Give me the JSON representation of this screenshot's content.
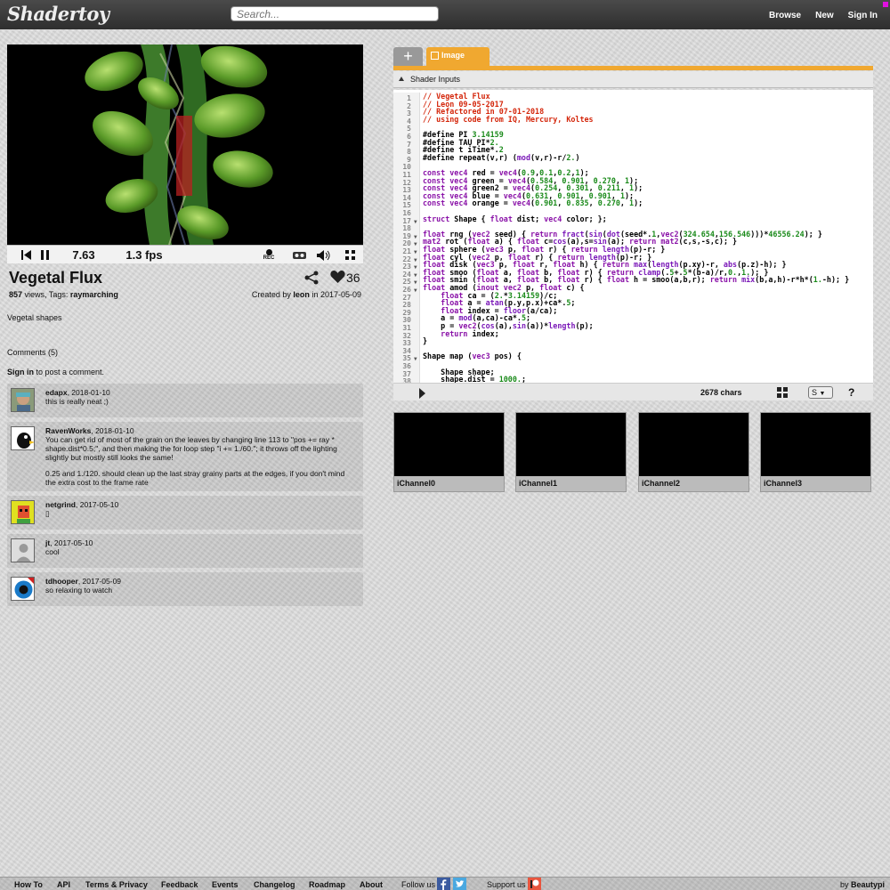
{
  "header": {
    "logo": "Shadertoy",
    "search_placeholder": "Search...",
    "nav": [
      "Browse",
      "New",
      "Sign In"
    ],
    "accent": "#e010e0"
  },
  "player": {
    "time": "7.63",
    "fps": "1.3 fps",
    "rec_label": "REC"
  },
  "shader": {
    "title": "Vegetal Flux",
    "likes": "36",
    "views": "857",
    "views_label": " views, Tags: ",
    "tag": "raymarching",
    "created_prefix": "Created by ",
    "author": "leon",
    "date_prefix": " in ",
    "date": "2017-05-09",
    "description": "Vegetal shapes"
  },
  "comments_section": {
    "header": "Comments (5)",
    "signin": "Sign in",
    "signin_suffix": " to post a comment."
  },
  "comments": [
    {
      "user": "edapx",
      "date": ", 2018-01-10",
      "text": [
        "this is really neat ;)"
      ]
    },
    {
      "user": "RavenWorks",
      "date": ", 2018-01-10",
      "text": [
        "You can get rid of most of the grain on the leaves by changing line 113 to \"pos += ray * shape.dist*0.5;\", and then making the for loop step \"i += 1./60.\"; it throws off the lighting slightly but mostly still looks the same!",
        "0.25 and 1./120. should clean up the last stray grainy parts at the edges, if you don't mind the extra cost to the frame rate"
      ]
    },
    {
      "user": "netgrind",
      "date": ", 2017-05-10",
      "text": [
        "▯"
      ]
    },
    {
      "user": "jt",
      "date": ", 2017-05-10",
      "text": [
        "cool"
      ]
    },
    {
      "user": "tdhooper",
      "date": ", 2017-05-09",
      "text": [
        "so relaxing to watch"
      ]
    }
  ],
  "editor": {
    "tab_plus": "+",
    "tab_image": "Image",
    "inputs_label": "Shader Inputs",
    "chars": "2678 chars",
    "select_value": "S",
    "help": "?",
    "accent": "#f0a830"
  },
  "code_lines": [
    {
      "n": "1",
      "t": "// Vegetal Flux",
      "cls": "c"
    },
    {
      "n": "2",
      "t": "// Leon 09-05-2017",
      "cls": "c"
    },
    {
      "n": "3",
      "t": "// Refactored in 07-01-2018",
      "cls": "c"
    },
    {
      "n": "4",
      "t": "// using code from IQ, Mercury, Koltes",
      "cls": "c"
    },
    {
      "n": "5",
      "t": "",
      "cls": "p"
    },
    {
      "n": "6",
      "t": "#define PI 3.14159",
      "cls": "p"
    },
    {
      "n": "7",
      "t": "#define TAU PI*2.",
      "cls": "p"
    },
    {
      "n": "8",
      "t": "#define t iTime*.2",
      "cls": "p"
    },
    {
      "n": "9",
      "t": "#define repeat(v,r) (mod(v,r)-r/2.)",
      "cls": "p"
    },
    {
      "n": "10",
      "t": "",
      "cls": "p"
    },
    {
      "n": "11",
      "t": "const vec4 red = vec4(0.9,0.1,0.2,1);",
      "cls": "p"
    },
    {
      "n": "12",
      "t": "const vec4 green = vec4(0.584, 0.901, 0.270, 1);",
      "cls": "p"
    },
    {
      "n": "13",
      "t": "const vec4 green2 = vec4(0.254, 0.301, 0.211, 1);",
      "cls": "p"
    },
    {
      "n": "14",
      "t": "const vec4 blue = vec4(0.631, 0.901, 0.901, 1);",
      "cls": "p"
    },
    {
      "n": "15",
      "t": "const vec4 orange = vec4(0.901, 0.835, 0.270, 1);",
      "cls": "p"
    },
    {
      "n": "16",
      "t": "",
      "cls": "p"
    },
    {
      "n": "17",
      "t": "struct Shape { float dist; vec4 color; };",
      "cls": "p"
    },
    {
      "n": "18",
      "t": "",
      "cls": "p"
    },
    {
      "n": "19",
      "t": "float rng (vec2 seed) { return fract(sin(dot(seed*.1,vec2(324.654,156.546)))*46556.24); }",
      "cls": "p"
    },
    {
      "n": "20",
      "t": "mat2 rot (float a) { float c=cos(a),s=sin(a); return mat2(c,s,-s,c); }",
      "cls": "p"
    },
    {
      "n": "21",
      "t": "float sphere (vec3 p, float r) { return length(p)-r; }",
      "cls": "p"
    },
    {
      "n": "22",
      "t": "float cyl (vec2 p, float r) { return length(p)-r; }",
      "cls": "p"
    },
    {
      "n": "23",
      "t": "float disk (vec3 p, float r, float h) { return max(length(p.xy)-r, abs(p.z)-h); }",
      "cls": "p"
    },
    {
      "n": "24",
      "t": "float smoo (float a, float b, float r) { return clamp(.5+.5*(b-a)/r,0.,1.); }",
      "cls": "p"
    },
    {
      "n": "25",
      "t": "float smin (float a, float b, float r) { float h = smoo(a,b,r); return mix(b,a,h)-r*h*(1.-h); }",
      "cls": "p"
    },
    {
      "n": "26",
      "t": "float amod (inout vec2 p, float c) {",
      "cls": "p"
    },
    {
      "n": "27",
      "t": "    float ca = (2.*3.14159)/c;",
      "cls": "p"
    },
    {
      "n": "28",
      "t": "    float a = atan(p.y,p.x)+ca*.5;",
      "cls": "p"
    },
    {
      "n": "29",
      "t": "    float index = floor(a/ca);",
      "cls": "p"
    },
    {
      "n": "30",
      "t": "    a = mod(a,ca)-ca*.5;",
      "cls": "p"
    },
    {
      "n": "31",
      "t": "    p = vec2(cos(a),sin(a))*length(p);",
      "cls": "p"
    },
    {
      "n": "32",
      "t": "    return index;",
      "cls": "p"
    },
    {
      "n": "33",
      "t": "}",
      "cls": "p"
    },
    {
      "n": "34",
      "t": "",
      "cls": "p"
    },
    {
      "n": "35",
      "t": "Shape map (vec3 pos) {",
      "cls": "p"
    },
    {
      "n": "36",
      "t": "",
      "cls": "p"
    },
    {
      "n": "37",
      "t": "    Shape shape;",
      "cls": "p"
    },
    {
      "n": "38",
      "t": "    shape.dist = 1000.;",
      "cls": "p"
    }
  ],
  "channels": [
    "iChannel0",
    "iChannel1",
    "iChannel2",
    "iChannel3"
  ],
  "footer": {
    "links": [
      "How To",
      "API",
      "Terms & Privacy",
      "Feedback",
      "Events",
      "Changelog",
      "Roadmap",
      "About"
    ],
    "follow": "Follow us",
    "support": "Support us",
    "by_prefix": "by ",
    "by": "Beautypi"
  }
}
